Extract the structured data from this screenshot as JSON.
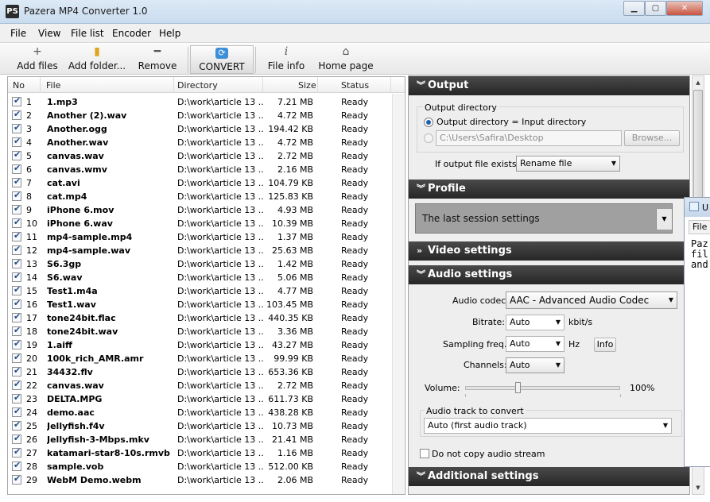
{
  "window": {
    "title": "Pazera MP4 Converter 1.0",
    "icon_text": "PS",
    "min_label": "▁",
    "max_label": "▢",
    "close_label": "✕"
  },
  "menu": [
    "File",
    "View",
    "File list",
    "Encoder",
    "Help"
  ],
  "toolbar": {
    "add_files": "Add files",
    "add_folder": "Add folder...",
    "remove": "Remove",
    "convert": "CONVERT",
    "file_info": "File info",
    "home_page": "Home page"
  },
  "filelist": {
    "headers": {
      "no": "No",
      "file": "File",
      "directory": "Directory",
      "size": "Size",
      "status": "Status"
    },
    "rows": [
      {
        "no": "1",
        "file": "1.mp3",
        "dir": "D:\\work\\article 13 ...",
        "size": "7.21 MB",
        "status": "Ready"
      },
      {
        "no": "2",
        "file": "Another (2).wav",
        "dir": "D:\\work\\article 13 ...",
        "size": "4.72 MB",
        "status": "Ready"
      },
      {
        "no": "3",
        "file": "Another.ogg",
        "dir": "D:\\work\\article 13 ...",
        "size": "194.42 KB",
        "status": "Ready"
      },
      {
        "no": "4",
        "file": "Another.wav",
        "dir": "D:\\work\\article 13 ...",
        "size": "4.72 MB",
        "status": "Ready"
      },
      {
        "no": "5",
        "file": "canvas.wav",
        "dir": "D:\\work\\article 13 ...",
        "size": "2.72 MB",
        "status": "Ready"
      },
      {
        "no": "6",
        "file": "canvas.wmv",
        "dir": "D:\\work\\article 13 ...",
        "size": "2.16 MB",
        "status": "Ready"
      },
      {
        "no": "7",
        "file": "cat.avi",
        "dir": "D:\\work\\article 13 ...",
        "size": "104.79 KB",
        "status": "Ready"
      },
      {
        "no": "8",
        "file": "cat.mp4",
        "dir": "D:\\work\\article 13 ...",
        "size": "125.83 KB",
        "status": "Ready"
      },
      {
        "no": "9",
        "file": "iPhone 6.mov",
        "dir": "D:\\work\\article 13 ...",
        "size": "4.93 MB",
        "status": "Ready"
      },
      {
        "no": "10",
        "file": "iPhone 6.wav",
        "dir": "D:\\work\\article 13 ...",
        "size": "10.39 MB",
        "status": "Ready"
      },
      {
        "no": "11",
        "file": "mp4-sample.mp4",
        "dir": "D:\\work\\article 13 ...",
        "size": "1.37 MB",
        "status": "Ready"
      },
      {
        "no": "12",
        "file": "mp4-sample.wav",
        "dir": "D:\\work\\article 13 ...",
        "size": "25.63 MB",
        "status": "Ready"
      },
      {
        "no": "13",
        "file": "S6.3gp",
        "dir": "D:\\work\\article 13 ...",
        "size": "1.42 MB",
        "status": "Ready"
      },
      {
        "no": "14",
        "file": "S6.wav",
        "dir": "D:\\work\\article 13 ...",
        "size": "5.06 MB",
        "status": "Ready"
      },
      {
        "no": "15",
        "file": "Test1.m4a",
        "dir": "D:\\work\\article 13 ...",
        "size": "4.77 MB",
        "status": "Ready"
      },
      {
        "no": "16",
        "file": "Test1.wav",
        "dir": "D:\\work\\article 13 ...",
        "size": "103.45 MB",
        "status": "Ready"
      },
      {
        "no": "17",
        "file": "tone24bit.flac",
        "dir": "D:\\work\\article 13 ...",
        "size": "440.35 KB",
        "status": "Ready"
      },
      {
        "no": "18",
        "file": "tone24bit.wav",
        "dir": "D:\\work\\article 13 ...",
        "size": "3.36 MB",
        "status": "Ready"
      },
      {
        "no": "19",
        "file": "1.aiff",
        "dir": "D:\\work\\article 13 ...",
        "size": "43.27 MB",
        "status": "Ready"
      },
      {
        "no": "20",
        "file": "100k_rich_AMR.amr",
        "dir": "D:\\work\\article 13 ...",
        "size": "99.99 KB",
        "status": "Ready"
      },
      {
        "no": "21",
        "file": "34432.flv",
        "dir": "D:\\work\\article 13 ...",
        "size": "653.36 KB",
        "status": "Ready"
      },
      {
        "no": "22",
        "file": "canvas.wav",
        "dir": "D:\\work\\article 13 ...",
        "size": "2.72 MB",
        "status": "Ready"
      },
      {
        "no": "23",
        "file": "DELTA.MPG",
        "dir": "D:\\work\\article 13 ...",
        "size": "611.73 KB",
        "status": "Ready"
      },
      {
        "no": "24",
        "file": "demo.aac",
        "dir": "D:\\work\\article 13 ...",
        "size": "438.28 KB",
        "status": "Ready"
      },
      {
        "no": "25",
        "file": "Jellyfish.f4v",
        "dir": "D:\\work\\article 13 ...",
        "size": "10.73 MB",
        "status": "Ready"
      },
      {
        "no": "26",
        "file": "Jellyfish-3-Mbps.mkv",
        "dir": "D:\\work\\article 13 ...",
        "size": "21.41 MB",
        "status": "Ready"
      },
      {
        "no": "27",
        "file": "katamari-star8-10s.rmvb",
        "dir": "D:\\work\\article 13 ...",
        "size": "1.16 MB",
        "status": "Ready"
      },
      {
        "no": "28",
        "file": "sample.vob",
        "dir": "D:\\work\\article 13 ...",
        "size": "512.00 KB",
        "status": "Ready"
      },
      {
        "no": "29",
        "file": "WebM Demo.webm",
        "dir": "D:\\work\\article 13 ...",
        "size": "2.06 MB",
        "status": "Ready"
      }
    ]
  },
  "panel": {
    "output": {
      "title": "Output",
      "dir_group": "Output directory",
      "opt_input_dir": "Output directory = Input directory",
      "path_value": "C:\\Users\\Safira\\Desktop",
      "browse": "Browse...",
      "if_exists_label": "If output file exists:",
      "if_exists_value": "Rename file"
    },
    "profile": {
      "title": "Profile",
      "value": "The last session settings"
    },
    "video": {
      "title": "Video settings"
    },
    "audio": {
      "title": "Audio settings",
      "codec_label": "Audio codec:",
      "codec_value": "AAC - Advanced Audio Codec",
      "bitrate_label": "Bitrate:",
      "bitrate_value": "Auto",
      "bitrate_unit": "kbit/s",
      "sampling_label": "Sampling freq.:",
      "sampling_value": "Auto",
      "sampling_unit": "Hz",
      "info_button": "Info",
      "channels_label": "Channels:",
      "channels_value": "Auto",
      "volume_label": "Volume:",
      "volume_value": "100%",
      "track_group": "Audio track to convert",
      "track_value": "Auto (first audio track)",
      "no_copy_label": "Do not copy audio stream"
    },
    "additional": {
      "title": "Additional settings"
    }
  },
  "bg_window": {
    "title_initial": "U",
    "menu_fragment": "File",
    "text_lines": [
      "Paz",
      "fil",
      "and"
    ]
  }
}
